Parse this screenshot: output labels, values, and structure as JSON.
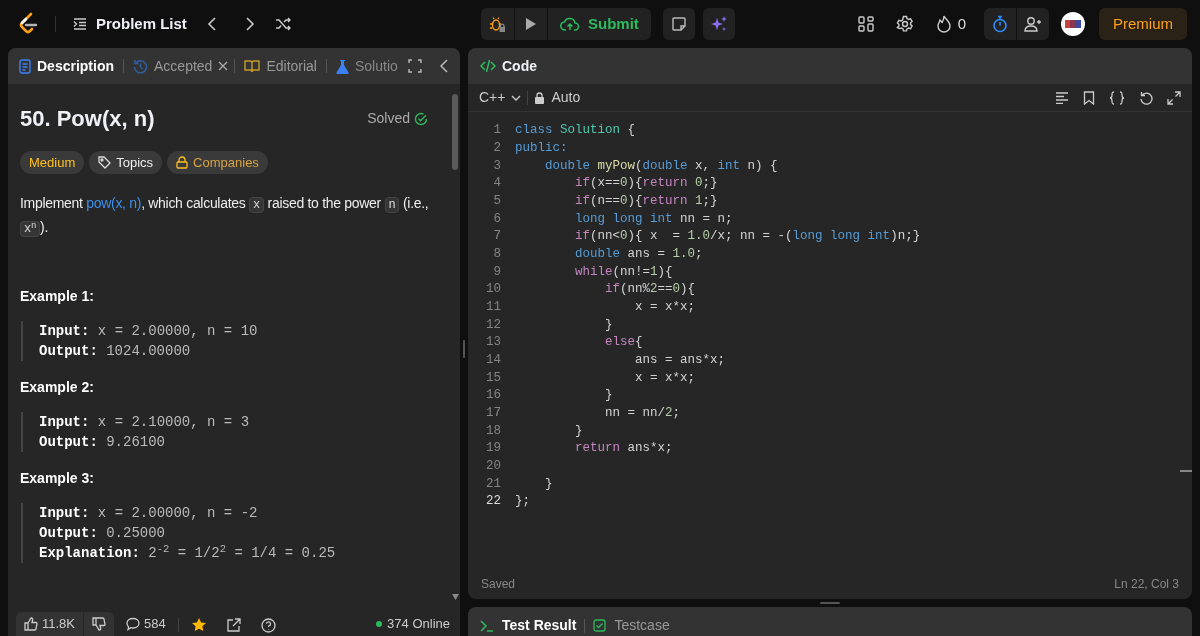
{
  "top_bar": {
    "problem_list": "Problem List",
    "submit": "Submit",
    "streak": "0",
    "premium": "Premium"
  },
  "left_tabs": [
    {
      "label": "Description",
      "kind": "description",
      "selected": true
    },
    {
      "label": "Accepted",
      "kind": "accepted",
      "selected": false
    },
    {
      "label": "Editorial",
      "kind": "editorial",
      "selected": false
    },
    {
      "label": "Solutio",
      "kind": "solutions",
      "selected": false
    }
  ],
  "problem": {
    "title": "50. Pow(x, n)",
    "status": "Solved",
    "difficulty": "Medium",
    "topics": "Topics",
    "companies": "Companies",
    "description": [
      {
        "kind": "text",
        "text": "Implement "
      },
      {
        "kind": "link",
        "text": "pow(x, n)"
      },
      {
        "kind": "text",
        "text": ", which calculates "
      },
      {
        "kind": "code",
        "text": "x"
      },
      {
        "kind": "text",
        "text": " raised to the power "
      },
      {
        "kind": "code",
        "text": "n"
      },
      {
        "kind": "text",
        "text": " (i.e., "
      },
      {
        "kind": "code",
        "text": "x$^{n}$"
      },
      {
        "kind": "text",
        "text": ")."
      }
    ],
    "examples": [
      {
        "title": "Example 1:",
        "lines": [
          {
            "label": "Input:",
            "value": "x = 2.00000, n = 10"
          },
          {
            "label": "Output:",
            "value": "1024.00000"
          }
        ]
      },
      {
        "title": "Example 2:",
        "lines": [
          {
            "label": "Input:",
            "value": "x = 2.10000, n = 3"
          },
          {
            "label": "Output:",
            "value": "9.26100"
          }
        ]
      },
      {
        "title": "Example 3:",
        "lines": [
          {
            "label": "Input:",
            "value": "x = 2.00000, n = -2"
          },
          {
            "label": "Output:",
            "value": "0.25000"
          },
          {
            "label": "Explanation:",
            "value": "2$^{-2}$ = 1/2$^{2}$ = 1/4 = 0.25"
          }
        ]
      }
    ]
  },
  "left_footer": {
    "likes": "11.8K",
    "comments": "584",
    "favorited": true,
    "online": "374 Online"
  },
  "code_panel": {
    "title": "Code",
    "language": "C++",
    "mode": "Auto",
    "status": "Saved",
    "cursor": "Ln 22, Col 3",
    "lines": [
      {
        "number": "1",
        "current": false,
        "tokens": [
          {
            "text": "class",
            "kind": "keyword"
          },
          {
            "text": " Solution",
            "kind": "type"
          },
          {
            "text": " {",
            "kind": "plain"
          }
        ]
      },
      {
        "number": "2",
        "current": false,
        "tokens": [
          {
            "text": "public:",
            "kind": "keyword"
          }
        ]
      },
      {
        "number": "3",
        "current": false,
        "tokens": [
          {
            "text": "    double",
            "kind": "keyword"
          },
          {
            "text": " myPow",
            "kind": "function"
          },
          {
            "text": "(",
            "kind": "plain"
          },
          {
            "text": "double",
            "kind": "keyword"
          },
          {
            "text": " x, ",
            "kind": "plain"
          },
          {
            "text": "int",
            "kind": "keyword"
          },
          {
            "text": " n) {",
            "kind": "plain"
          }
        ]
      },
      {
        "number": "4",
        "current": false,
        "tokens": [
          {
            "text": "        if",
            "kind": "control"
          },
          {
            "text": "(x==",
            "kind": "plain"
          },
          {
            "text": "0",
            "kind": "number"
          },
          {
            "text": "){",
            "kind": "plain"
          },
          {
            "text": "return",
            "kind": "control"
          },
          {
            "text": " 0",
            "kind": "number"
          },
          {
            "text": ";}",
            "kind": "plain"
          }
        ]
      },
      {
        "number": "5",
        "current": false,
        "tokens": [
          {
            "text": "        if",
            "kind": "control"
          },
          {
            "text": "(n==",
            "kind": "plain"
          },
          {
            "text": "0",
            "kind": "number"
          },
          {
            "text": "){",
            "kind": "plain"
          },
          {
            "text": "return",
            "kind": "control"
          },
          {
            "text": " 1",
            "kind": "number"
          },
          {
            "text": ";}",
            "kind": "plain"
          }
        ]
      },
      {
        "number": "6",
        "current": false,
        "tokens": [
          {
            "text": "        long long int",
            "kind": "keyword"
          },
          {
            "text": " nn = n;",
            "kind": "plain"
          }
        ]
      },
      {
        "number": "7",
        "current": false,
        "tokens": [
          {
            "text": "        if",
            "kind": "control"
          },
          {
            "text": "(nn<",
            "kind": "plain"
          },
          {
            "text": "0",
            "kind": "number"
          },
          {
            "text": "){ x  = ",
            "kind": "plain"
          },
          {
            "text": "1.0",
            "kind": "number"
          },
          {
            "text": "/x; nn = -(",
            "kind": "plain"
          },
          {
            "text": "long long int",
            "kind": "keyword"
          },
          {
            "text": ")n;}",
            "kind": "plain"
          }
        ]
      },
      {
        "number": "8",
        "current": false,
        "tokens": [
          {
            "text": "        double",
            "kind": "keyword"
          },
          {
            "text": " ans = ",
            "kind": "plain"
          },
          {
            "text": "1.0",
            "kind": "number"
          },
          {
            "text": ";",
            "kind": "plain"
          }
        ]
      },
      {
        "number": "9",
        "current": false,
        "tokens": [
          {
            "text": "        while",
            "kind": "control"
          },
          {
            "text": "(nn!=",
            "kind": "plain"
          },
          {
            "text": "1",
            "kind": "number"
          },
          {
            "text": "){",
            "kind": "plain"
          }
        ]
      },
      {
        "number": "10",
        "current": false,
        "tokens": [
          {
            "text": "            if",
            "kind": "control"
          },
          {
            "text": "(nn%",
            "kind": "plain"
          },
          {
            "text": "2",
            "kind": "number"
          },
          {
            "text": "==",
            "kind": "plain"
          },
          {
            "text": "0",
            "kind": "number"
          },
          {
            "text": "){",
            "kind": "plain"
          }
        ]
      },
      {
        "number": "11",
        "current": false,
        "tokens": [
          {
            "text": "                x = x*x;",
            "kind": "plain"
          }
        ]
      },
      {
        "number": "12",
        "current": false,
        "tokens": [
          {
            "text": "            }",
            "kind": "plain"
          }
        ]
      },
      {
        "number": "13",
        "current": false,
        "tokens": [
          {
            "text": "            else",
            "kind": "control"
          },
          {
            "text": "{",
            "kind": "plain"
          }
        ]
      },
      {
        "number": "14",
        "current": false,
        "tokens": [
          {
            "text": "                ans = ans*x;",
            "kind": "plain"
          }
        ]
      },
      {
        "number": "15",
        "current": false,
        "tokens": [
          {
            "text": "                x = x*x;",
            "kind": "plain"
          }
        ]
      },
      {
        "number": "16",
        "current": false,
        "tokens": [
          {
            "text": "            }",
            "kind": "plain"
          }
        ]
      },
      {
        "number": "17",
        "current": false,
        "tokens": [
          {
            "text": "            nn = nn/",
            "kind": "plain"
          },
          {
            "text": "2",
            "kind": "number"
          },
          {
            "text": ";",
            "kind": "plain"
          }
        ]
      },
      {
        "number": "18",
        "current": false,
        "tokens": [
          {
            "text": "        }",
            "kind": "plain"
          }
        ]
      },
      {
        "number": "19",
        "current": false,
        "tokens": [
          {
            "text": "        return",
            "kind": "control"
          },
          {
            "text": " ans*x;",
            "kind": "plain"
          }
        ]
      },
      {
        "number": "20",
        "current": false
      },
      {
        "number": "21",
        "current": false,
        "tokens": [
          {
            "text": "    }",
            "kind": "plain"
          }
        ]
      },
      {
        "number": "22",
        "current": true,
        "tokens": [
          {
            "text": "};",
            "kind": "plain"
          }
        ]
      }
    ]
  },
  "bottom_tabs": [
    {
      "label": "Test Result",
      "kind": "result",
      "selected": true
    },
    {
      "label": "Testcase",
      "kind": "testcase",
      "selected": false
    }
  ]
}
